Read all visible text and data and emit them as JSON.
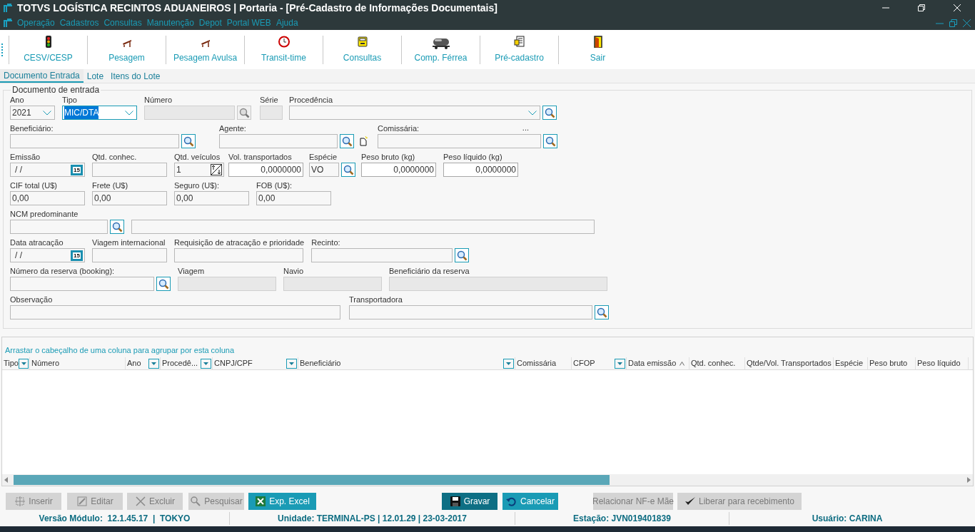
{
  "window": {
    "title": "TOTVS LOGÍSTICA RECINTOS ADUANEIROS | Portaria - [Pré-Cadastro de Informações Documentais]"
  },
  "menu": [
    "Operação",
    "Cadastros",
    "Consultas",
    "Manutenção",
    "Depot",
    "Portal WEB",
    "Ajuda"
  ],
  "toolbar": [
    "CESV/CESP",
    "Pesagem",
    "Pesagem Avulsa",
    "Transit-time",
    "Consultas",
    "Comp. Férrea",
    "Pré-cadastro",
    "Sair"
  ],
  "tabs": [
    {
      "label": "Documento Entrada",
      "selected": true
    },
    {
      "label": "Lote",
      "selected": false
    },
    {
      "label": "Itens do Lote",
      "selected": false
    }
  ],
  "form": {
    "title": "Documento de entrada",
    "lines": [
      {
        "fields": [
          {
            "label": "Ano",
            "kind": "combo",
            "value": "2021",
            "lookup": false,
            "disabled": false,
            "focused": false
          },
          {
            "label": "Tipo",
            "kind": "combo",
            "value": "MIC/DTA",
            "lookup": false,
            "disabled": false,
            "focused": true
          },
          {
            "label": "Número",
            "kind": "text",
            "lookup": true,
            "disabled": true,
            "focused": false
          },
          {
            "label": "Série",
            "kind": "text",
            "lookup": false,
            "disabled": true,
            "focused": false
          },
          {
            "label": "Procedência",
            "kind": "combo",
            "lookup": true,
            "disabled": false,
            "focused": false
          }
        ]
      },
      {
        "fields": [
          {
            "label": "Beneficiário:",
            "kind": "text",
            "lookup": true,
            "disabled": false,
            "focused": false
          },
          {
            "label": "Agente:",
            "kind": "text",
            "lookup": true,
            "disabled": false,
            "focused": false
          },
          {
            "label": "Comissária:",
            "note": "...",
            "kind": "text",
            "lookup": true,
            "disabled": false,
            "focused": false
          }
        ]
      },
      {
        "fields": [
          {
            "label": "Emissão",
            "kind": "date",
            "value": "/ /",
            "calendar_label": "15",
            "lookup": false,
            "disabled": false,
            "focused": false
          },
          {
            "label": "Qtd. conhec.",
            "kind": "text",
            "lookup": false,
            "disabled": false,
            "focused": false
          },
          {
            "label": "Qtd. veículos",
            "kind": "spin",
            "value": "1",
            "lookup": false,
            "disabled": false,
            "focused": false
          },
          {
            "label": "Vol. transportados",
            "kind": "number",
            "value": "0,0000000",
            "lookup": false,
            "disabled": false,
            "focused": false
          },
          {
            "label": "Espécie",
            "kind": "text",
            "value": "VO",
            "lookup": true,
            "disabled": false,
            "focused": false
          },
          {
            "label": "Peso bruto (kg)",
            "kind": "number",
            "value": "0,0000000",
            "lookup": false,
            "disabled": false,
            "focused": false
          },
          {
            "label": "Peso líquido (kg)",
            "kind": "number",
            "value": "0,0000000",
            "lookup": false,
            "disabled": false,
            "focused": false
          }
        ]
      },
      {
        "fields": [
          {
            "label": "CIF total (U$)",
            "kind": "text",
            "value": "0,00",
            "lookup": false,
            "disabled": false,
            "focused": false
          },
          {
            "label": "Frete (U$)",
            "kind": "text",
            "value": "0,00",
            "lookup": false,
            "disabled": false,
            "focused": false
          },
          {
            "label": "Seguro (U$):",
            "kind": "text",
            "value": "0,00",
            "lookup": false,
            "disabled": false,
            "focused": false
          },
          {
            "label": "FOB (U$):",
            "kind": "text",
            "value": "0,00",
            "lookup": false,
            "disabled": false,
            "focused": false
          }
        ]
      },
      {
        "fields": [
          {
            "label": "NCM predominante",
            "kind": "text",
            "lookup": true,
            "disabled": false,
            "focused": false
          },
          {
            "kind": "text",
            "lookup": false,
            "disabled": false,
            "focused": false
          }
        ]
      },
      {
        "fields": [
          {
            "label": "Data atracação",
            "kind": "date",
            "value": "/ /",
            "calendar_label": "15",
            "lookup": false,
            "disabled": false,
            "focused": false
          },
          {
            "label": "Viagem internacional",
            "kind": "text",
            "lookup": false,
            "disabled": false,
            "focused": false
          },
          {
            "label": "Requisição de atracação e prioridade",
            "kind": "text",
            "lookup": false,
            "disabled": false,
            "focused": false
          },
          {
            "label": "Recinto:",
            "kind": "text",
            "lookup": true,
            "disabled": false,
            "focused": false
          }
        ]
      },
      {
        "fields": [
          {
            "label": "Número da reserva (booking):",
            "kind": "text",
            "lookup": true,
            "disabled": false,
            "focused": false
          },
          {
            "label": "Viagem",
            "kind": "text",
            "lookup": false,
            "disabled": true,
            "focused": false
          },
          {
            "label": "Navio",
            "kind": "text",
            "lookup": false,
            "disabled": true,
            "focused": false
          },
          {
            "label": "Beneficiário da reserva",
            "kind": "text",
            "lookup": false,
            "disabled": true,
            "focused": false
          }
        ]
      },
      {
        "fields": [
          {
            "label": "Observação",
            "kind": "text",
            "lookup": false,
            "disabled": false,
            "focused": false
          },
          {
            "label": "Transportadora",
            "kind": "text",
            "lookup": true,
            "disabled": false,
            "focused": false
          }
        ]
      }
    ]
  },
  "grid": {
    "group_hint": "Arrastar o cabeçalho de uma coluna para agrupar por esta coluna",
    "columns": [
      {
        "label": "Tipo",
        "filter": true,
        "sorted": false
      },
      {
        "label": "Número",
        "filter": false,
        "sorted": false
      },
      {
        "label": "Ano",
        "filter": true,
        "sorted": false
      },
      {
        "label": "Procedê...",
        "filter": true,
        "sorted": false
      },
      {
        "label": "CNPJ/CPF",
        "filter": true,
        "sorted": false
      },
      {
        "label": "Beneficiário",
        "filter": true,
        "sorted": false
      },
      {
        "label": "Comissária",
        "filter": false,
        "sorted": false
      },
      {
        "label": "CFOP",
        "filter": true,
        "sorted": false
      },
      {
        "label": "Data emissão",
        "filter": false,
        "sorted": true
      },
      {
        "label": "Qtd. conhec.",
        "filter": false,
        "sorted": false
      },
      {
        "label": "Qtde/Vol. Transportados",
        "filter": false,
        "sorted": false
      },
      {
        "label": "Espécie",
        "filter": false,
        "sorted": false
      },
      {
        "label": "Peso bruto",
        "filter": false,
        "sorted": false
      },
      {
        "label": "Peso líquido",
        "filter": false,
        "sorted": false
      }
    ]
  },
  "buttons": [
    {
      "label": "Inserir",
      "kind": "normal",
      "disabled": true
    },
    {
      "label": "Editar",
      "kind": "normal",
      "disabled": true
    },
    {
      "label": "Excluir",
      "kind": "normal",
      "disabled": true
    },
    {
      "label": "Pesquisar",
      "kind": "normal",
      "disabled": true
    },
    {
      "label": "Exp. Excel",
      "kind": "normal",
      "disabled": false
    },
    {
      "label": "Gravar",
      "kind": "primary",
      "disabled": false
    },
    {
      "label": "Cancelar",
      "kind": "normal",
      "disabled": false
    },
    {
      "label": "Relacionar NF-e Mãe",
      "kind": "normal",
      "disabled": true
    },
    {
      "label": "Liberar para recebimento",
      "kind": "normal",
      "disabled": true
    }
  ],
  "status_bar": [
    "Versão Módulo:  12.1.45.17  |  TOKYO",
    "Unidade: TERMINAL-PS | 12.01.29 | 23-03-2017",
    "Estação: JVN019401839",
    "Usuário: CARINA"
  ]
}
